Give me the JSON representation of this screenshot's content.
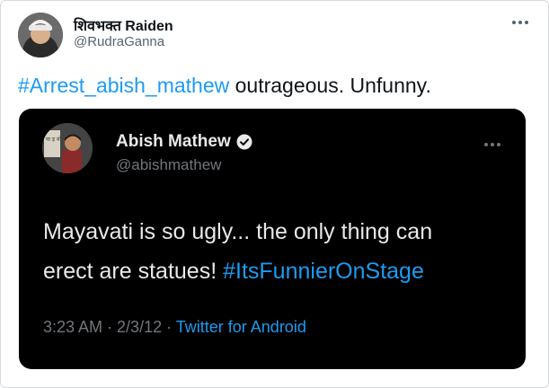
{
  "tweet": {
    "display_name": "शिवभक्त Raiden",
    "handle": "@RudraGanna",
    "hashtag": "#Arrest_abish_mathew",
    "text_rest": " outrageous. Unfunny."
  },
  "quoted": {
    "display_name": "Abish Mathew",
    "handle": "@abishmathew",
    "line1": "Mayavati is so ugly... the only thing can",
    "line2_text": "erect are statues! ",
    "line2_hashtag": "#ItsFunnierOnStage",
    "time": "3:23 AM",
    "sep": " · ",
    "date": "2/3/12",
    "source": "Twitter for Android",
    "avatar_sign": "पा ड़ मो"
  },
  "colors": {
    "link": "#1d9bf0",
    "quote_background": "#000000"
  },
  "icons": [
    "more-options-icon",
    "verified-badge-icon"
  ]
}
